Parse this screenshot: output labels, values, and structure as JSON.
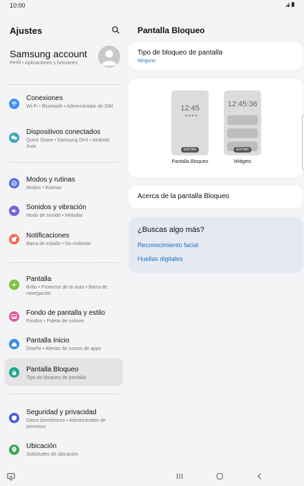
{
  "status_bar": {
    "time": "10:00"
  },
  "left": {
    "title": "Ajustes",
    "account": {
      "name": "Samsung account",
      "subtitle": "Perfil  •  Aplicaciones y funciones"
    },
    "items": [
      {
        "title": "Conexiones",
        "desc": "Wi-Fi  •  Bluetooth  •  Administrador de SIM",
        "color": "#3d8ef0"
      },
      {
        "title": "Dispositivos conectados",
        "desc": "Quick Share  •  Samsung DeX  •  Android Auto",
        "color": "#3aa6b9"
      },
      {
        "title": "Modos y rutinas",
        "desc": "Modos  •  Rutinas",
        "color": "#5b6fdc"
      },
      {
        "title": "Sonidos y vibración",
        "desc": "Modo de sonido  •  Melodía",
        "color": "#7a5fd8"
      },
      {
        "title": "Notificaciones",
        "desc": "Barra de estado  •  No molestar",
        "color": "#ef6a52"
      },
      {
        "title": "Pantalla",
        "desc": "Brillo  •  Protector de la vista  •  Barra de navegación",
        "color": "#7cc23a"
      },
      {
        "title": "Fondo de pantalla y estilo",
        "desc": "Fondos  •  Paleta de colores",
        "color": "#e0579a"
      },
      {
        "title": "Pantalla Inicio",
        "desc": "Diseño  •  Alertas de iconos de apps",
        "color": "#3a8be6"
      },
      {
        "title": "Pantalla Bloqueo",
        "desc": "Tipo de bloqueo de pantalla",
        "color": "#1fa98e"
      },
      {
        "title": "Seguridad y privacidad",
        "desc": "Datos biométricos  •  Administrador de permisos",
        "color": "#4a62d8"
      },
      {
        "title": "Ubicación",
        "desc": "Solicitudes de ubicación",
        "color": "#39a954"
      }
    ]
  },
  "right": {
    "title": "Pantalla Bloqueo",
    "lock_type": {
      "title": "Tipo de bloqueo de pantalla",
      "value": "Ninguno"
    },
    "previews": [
      {
        "clock": "12:45",
        "edit": "EDITAR",
        "label": "Pantalla Bloqueo"
      },
      {
        "clock": "12:45:36",
        "edit": "EDITAR",
        "label": "Widgets"
      }
    ],
    "about": "Acerca de la pantalla Bloqueo",
    "help": {
      "title": "¿Buscas algo más?",
      "links": [
        "Reconocimiento facial",
        "Huellas digitales"
      ]
    }
  },
  "accent_color": "#1a73c8"
}
